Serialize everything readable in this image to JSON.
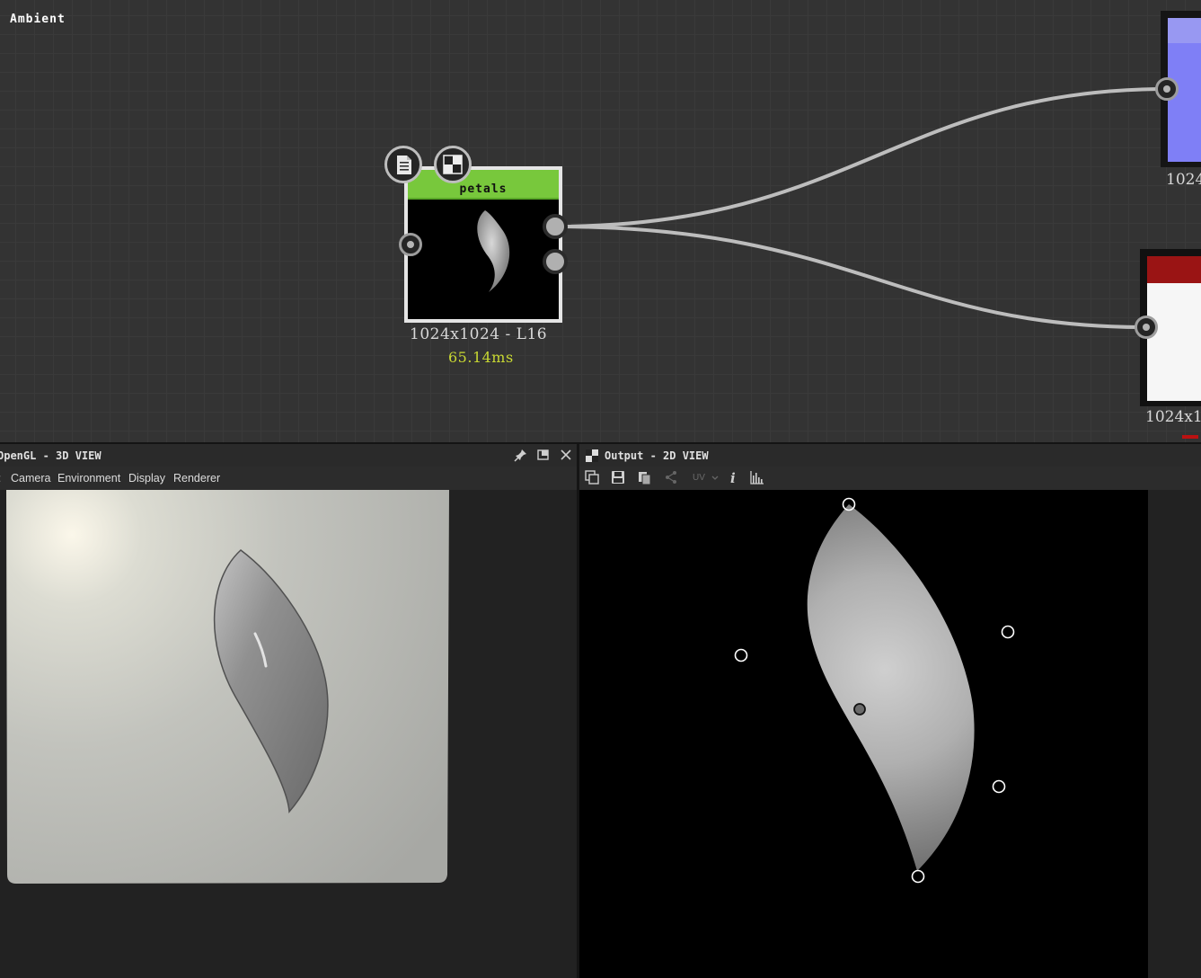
{
  "graph": {
    "petals_node": {
      "title": "petals",
      "resolution": "1024x1024 - L16",
      "time": "65.14ms",
      "header_color": "#78c83c"
    },
    "normal_node": {
      "resolution": "1024",
      "color": "#7f7ff6"
    },
    "ambient_node": {
      "title": "Ambient",
      "resolution": "1024x1",
      "header_color": "#9a1414"
    },
    "icons": [
      "document-icon",
      "checkerboard-icon"
    ]
  },
  "view3d": {
    "title": "OpenGL - 3D VIEW",
    "menu": [
      "Camera",
      "Environment",
      "Display",
      "Renderer"
    ],
    "buttons": [
      "pin-icon",
      "maximize-icon",
      "close-icon"
    ]
  },
  "view2d": {
    "title": "Output - 2D VIEW",
    "toolbar": {
      "uv_label": "UV",
      "icons": [
        "copy-view-icon",
        "save-icon",
        "clipboard-icon",
        "share-icon",
        "uv-dropdown",
        "info-icon",
        "histogram-icon"
      ]
    }
  }
}
